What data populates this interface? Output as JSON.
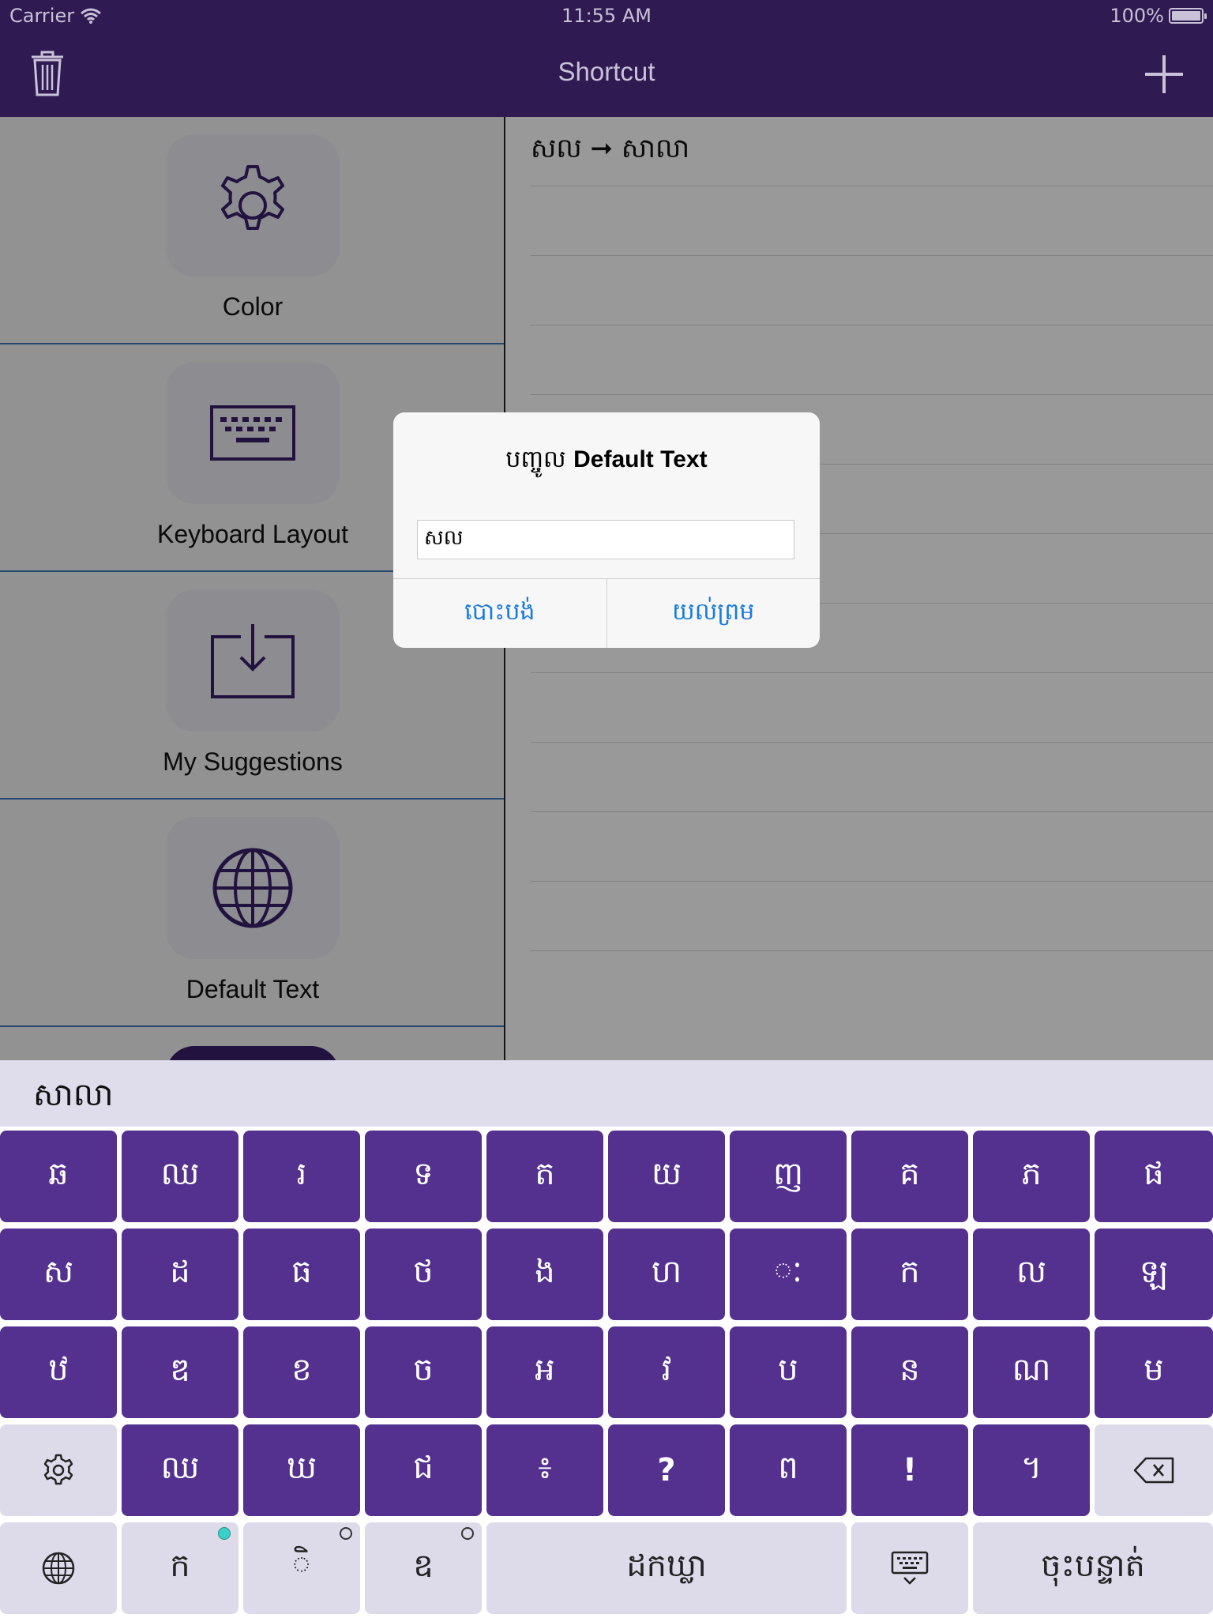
{
  "status_bar": {
    "carrier": "Carrier",
    "time": "11:55 AM",
    "battery": "100%"
  },
  "nav": {
    "title": "Shortcut",
    "left_icon": "trash-icon",
    "right_icon": "plus-icon"
  },
  "sidebar": {
    "items": [
      {
        "label": "Color",
        "icon": "gear-icon"
      },
      {
        "label": "Keyboard Layout",
        "icon": "keyboard-icon"
      },
      {
        "label": "My Suggestions",
        "icon": "download-icon"
      },
      {
        "label": "Default Text",
        "icon": "globe-icon"
      }
    ]
  },
  "shortcut_list": {
    "items": [
      {
        "text": "សល ➞ សាលា"
      }
    ]
  },
  "alert": {
    "title_prefix": "បញ្ចូល",
    "title_bold": "Default Text",
    "input_value": "សល",
    "cancel_label": "បោះបង់",
    "ok_label": "យល់ព្រម"
  },
  "keyboard": {
    "suggestion": "សាលា",
    "rows": [
      [
        "ឆ",
        "ឈ",
        "រ",
        "ទ",
        "ត",
        "យ",
        "ញ",
        "គ",
        "ភ",
        "ផ"
      ],
      [
        "ស",
        "ដ",
        "ធ",
        "ថ",
        "ង",
        "ហ",
        "ៈ",
        "ក",
        "ល",
        "ឡ"
      ],
      [
        "ឋ",
        "ឌ",
        "ខ",
        "ច",
        "អ",
        "វ",
        "ប",
        "ន",
        "ណ",
        "ម"
      ],
      [
        "ឈ",
        "ឃ",
        "ជ",
        "៖",
        "?",
        "ព",
        "!",
        "។"
      ]
    ],
    "bottom": {
      "left_key": "ក",
      "mark_key": "ិ",
      "third_key": "ឧ",
      "space_label": "ដកឃ្លា",
      "return_label": "ចុះបន្ទាត់"
    },
    "colors": {
      "key": "#54308f",
      "function_key": "#dddbea",
      "nav": "#2f1a52"
    }
  }
}
